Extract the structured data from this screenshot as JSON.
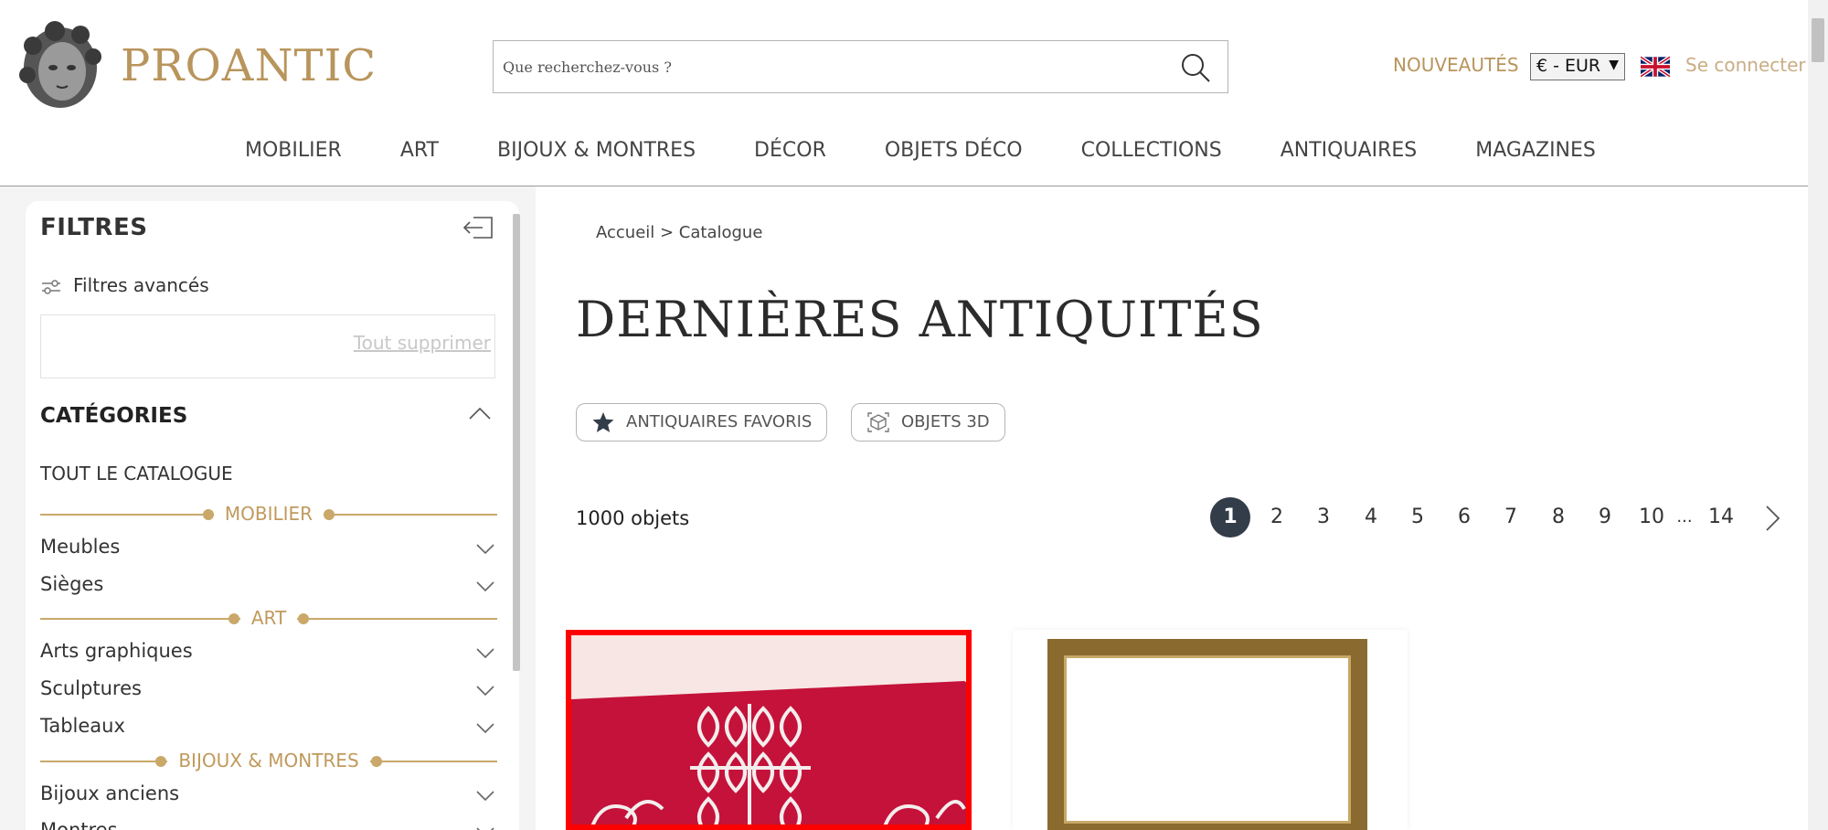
{
  "header": {
    "brand": "PROANTIC",
    "search_placeholder": "Que recherchez-vous ?",
    "nouveautes": "NOUVEAUTÉS",
    "currency": "€ - EUR",
    "login": "Se connecter"
  },
  "nav": [
    "MOBILIER",
    "ART",
    "BIJOUX & MONTRES",
    "DÉCOR",
    "OBJETS DÉCO",
    "COLLECTIONS",
    "ANTIQUAIRES",
    "MAGAZINES"
  ],
  "sidebar": {
    "title": "FILTRES",
    "advanced": "Filtres avancés",
    "clear_all": "Tout supprimer",
    "categories_title": "CATÉGORIES",
    "all_catalog": "TOUT LE CATALOGUE",
    "groups": [
      {
        "label": "MOBILIER",
        "items": [
          "Meubles",
          "Sièges"
        ]
      },
      {
        "label": "ART",
        "items": [
          "Arts graphiques",
          "Sculptures",
          "Tableaux"
        ]
      },
      {
        "label": "BIJOUX & MONTRES",
        "items": [
          "Bijoux anciens",
          "Montres"
        ]
      }
    ]
  },
  "main": {
    "breadcrumb": "Accueil > Catalogue",
    "title": "DERNIÈRES ANTIQUITÉS",
    "chip_favorites": "ANTIQUAIRES FAVORIS",
    "chip_3d": "OBJETS 3D",
    "count": "1000 objets",
    "pages": [
      "1",
      "2",
      "3",
      "4",
      "5",
      "6",
      "7",
      "8",
      "9",
      "10",
      "...",
      "14"
    ],
    "current_page": "1"
  },
  "colors": {
    "gold": "#b8955c",
    "active_page": "#333d4a",
    "selected_card_border": "#ff0000"
  }
}
